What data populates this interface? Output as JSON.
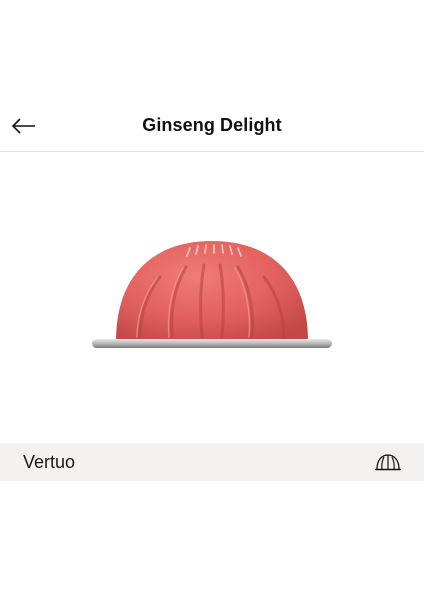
{
  "header": {
    "back_icon": "arrow-left-icon",
    "title": "Ginseng Delight"
  },
  "product": {
    "image_icon": "vertuo-capsule-image",
    "capsule_color": "#e2615e"
  },
  "system_bar": {
    "label": "Vertuo",
    "icon": "vertuo-capsule-outline-icon"
  }
}
